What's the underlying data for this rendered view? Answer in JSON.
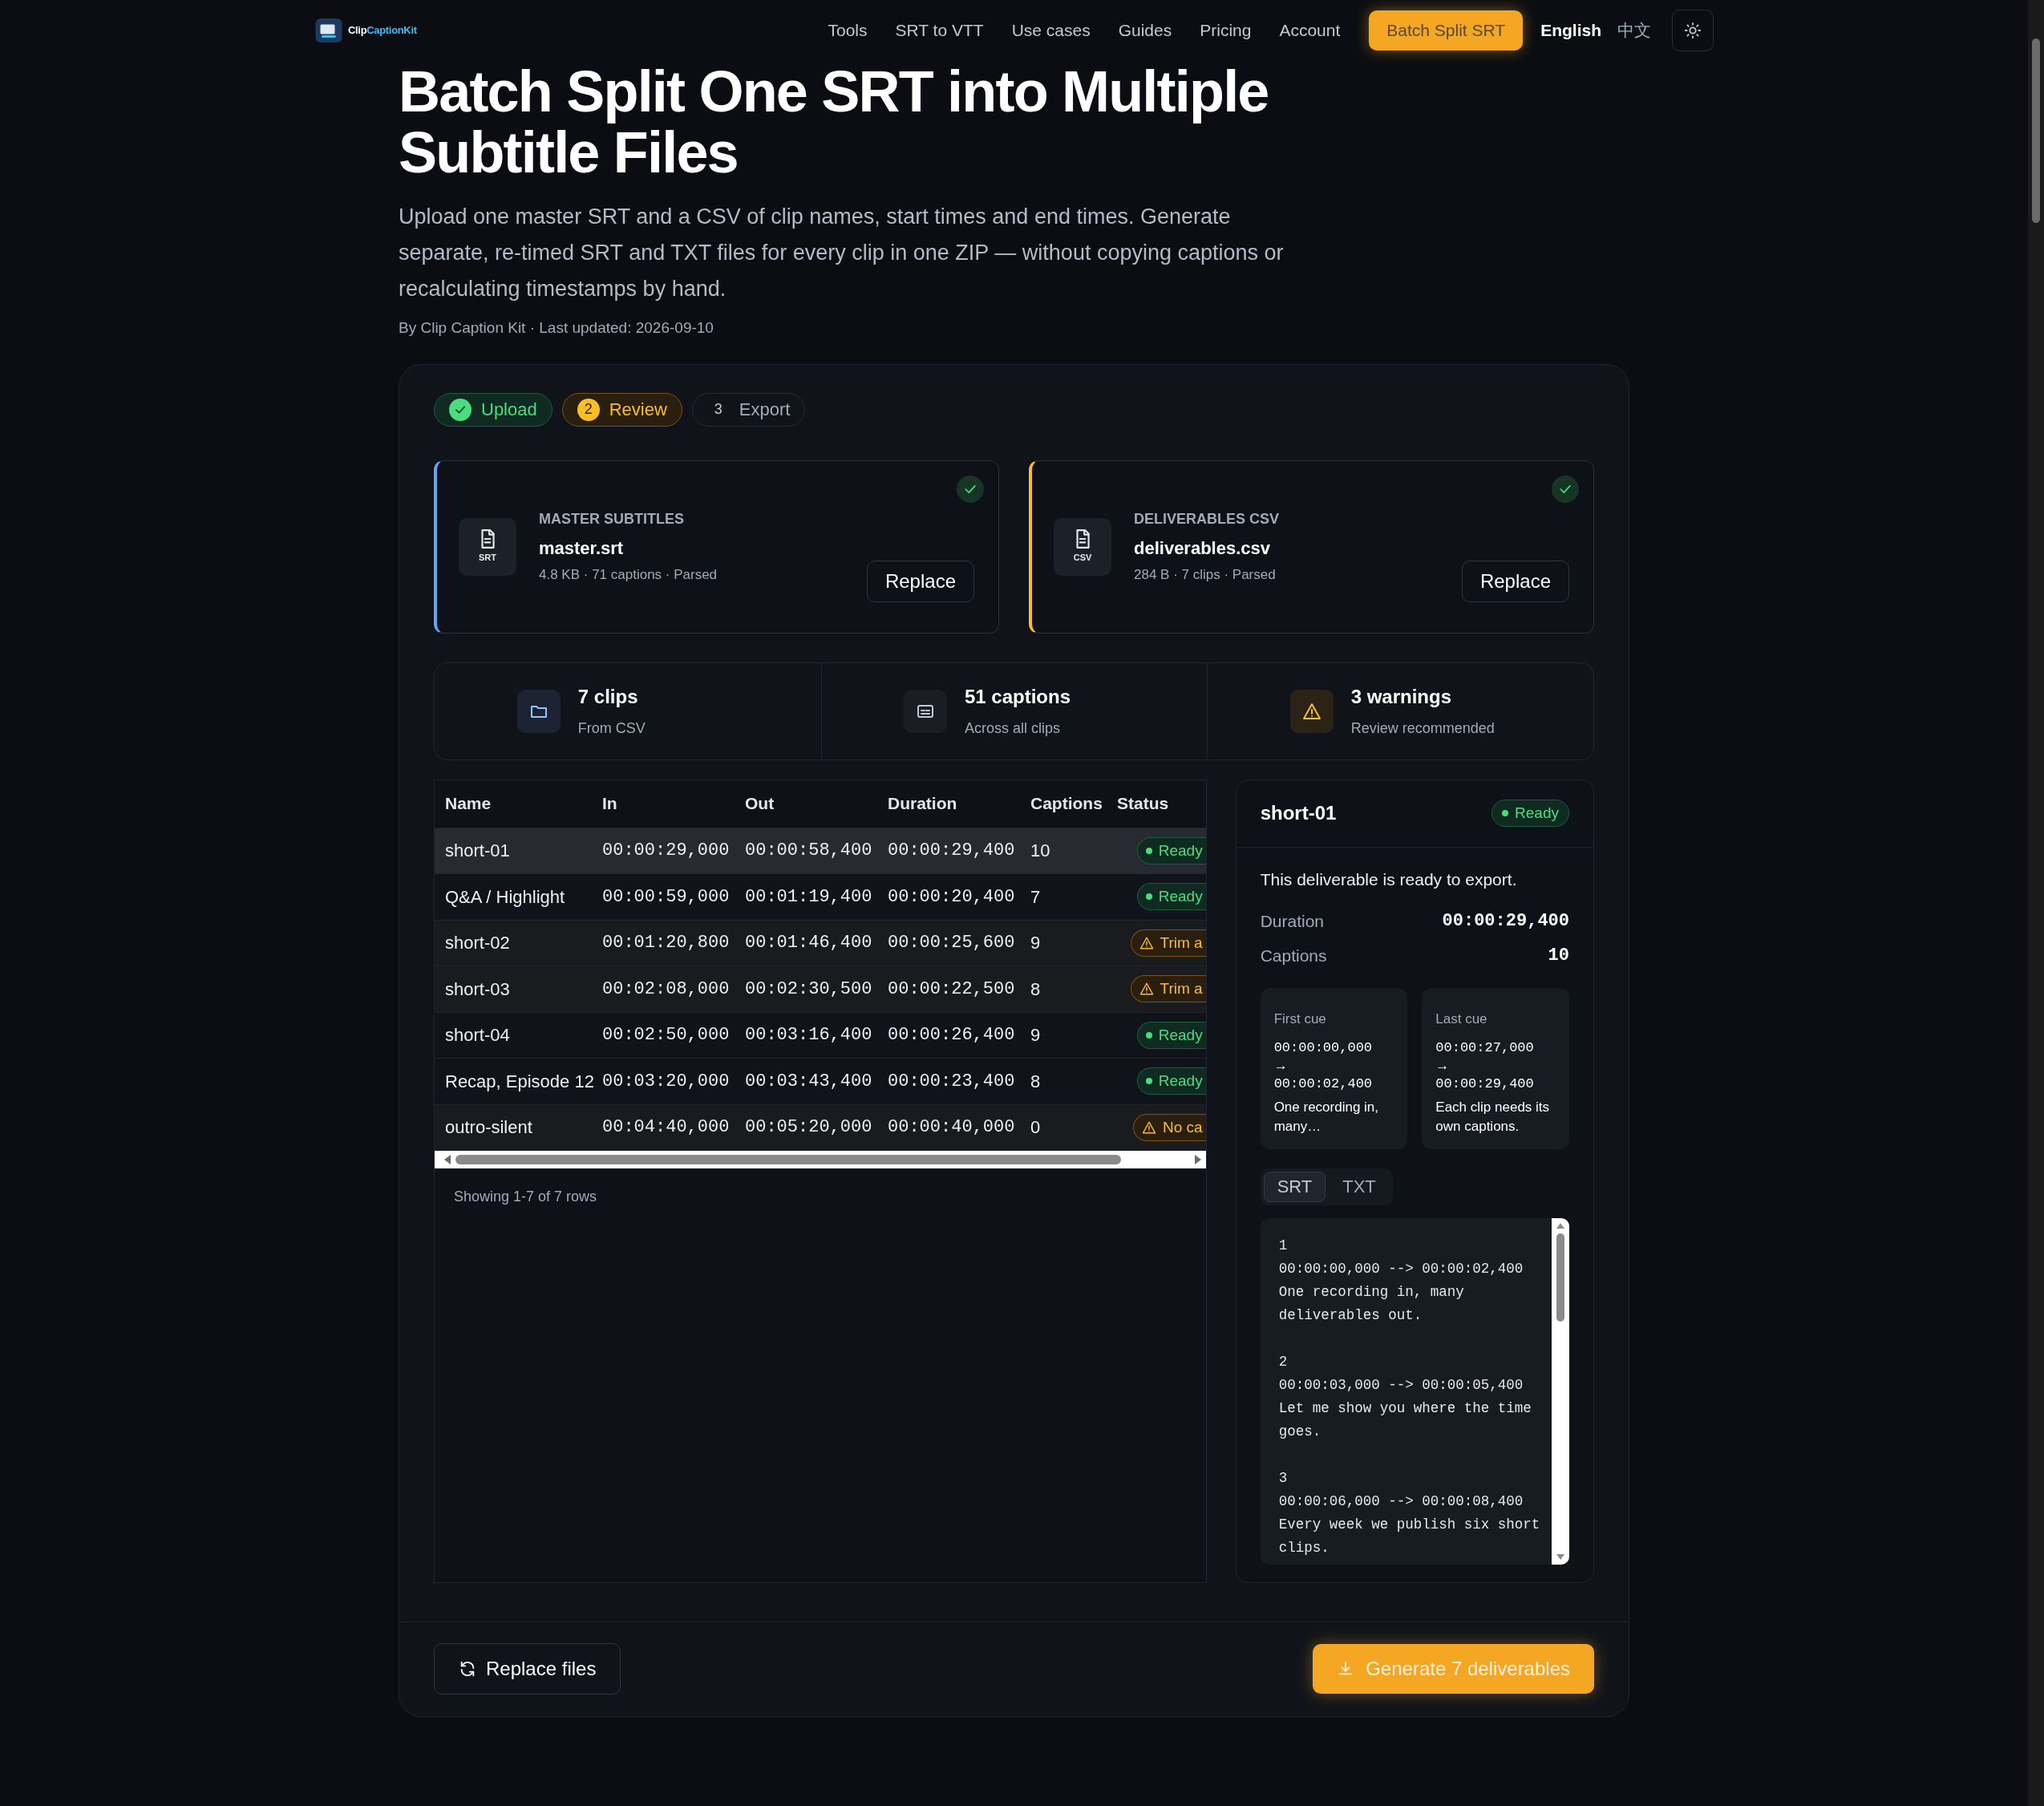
{
  "nav": {
    "brand": {
      "part1": "Clip",
      "part2": "CaptionKit"
    },
    "links": [
      "Tools",
      "SRT to VTT",
      "Use cases",
      "Guides",
      "Pricing",
      "Account"
    ],
    "cta": "Batch Split SRT",
    "languages": [
      {
        "label": "English",
        "selected": true
      },
      {
        "label": "中文",
        "selected": false
      }
    ]
  },
  "title": "Batch Split One SRT into Multiple Subtitle Files",
  "intro": "Upload one master SRT and a CSV of clip names, start times and end times. Generate separate, re-timed SRT and TXT files for every clip in one ZIP — without copying captions or recalculating timestamps by hand.",
  "byline": "By Clip Caption Kit · Last updated: 2026-09-10",
  "steps": [
    {
      "label": "Upload",
      "completed": true,
      "selected": false
    },
    {
      "number": "2",
      "label": "Review",
      "completed": false,
      "selected": true
    },
    {
      "number": "3",
      "label": "Export",
      "completed": false,
      "selected": false
    }
  ],
  "files": [
    {
      "tag": "SRT",
      "label": "MASTER SUBTITLES",
      "name": "master.srt",
      "meta": "4.8 KB · 71 captions · Parsed",
      "button": "Replace",
      "color": "#60a5fa",
      "parsed": true
    },
    {
      "tag": "CSV",
      "label": "DELIVERABLES CSV",
      "name": "deliverables.csv",
      "meta": "284 B · 7 clips · Parsed",
      "button": "Replace",
      "color": "#fbbf24",
      "parsed": true
    }
  ],
  "stats": [
    {
      "kind": "clips",
      "value": "7 clips",
      "caption": "From CSV"
    },
    {
      "kind": "captions",
      "value": "51 captions",
      "caption": "Across all clips"
    },
    {
      "kind": "warnings",
      "value": "3 warnings",
      "caption": "Review recommended"
    }
  ],
  "table": {
    "columns": [
      "Name",
      "In",
      "Out",
      "Duration",
      "Captions",
      "Status"
    ],
    "rows": [
      {
        "name": "short-01",
        "in": "00:00:29,000",
        "out": "00:00:58,400",
        "duration": "00:00:29,400",
        "captions": "10",
        "status": {
          "kind": "ready",
          "label": "Ready"
        },
        "selected": true
      },
      {
        "name": "Q&A / Highlight",
        "in": "00:00:59,000",
        "out": "00:01:19,400",
        "duration": "00:00:20,400",
        "captions": "7",
        "status": {
          "kind": "ready",
          "label": "Ready"
        },
        "selected": false
      },
      {
        "name": "short-02",
        "in": "00:01:20,800",
        "out": "00:01:46,400",
        "duration": "00:00:25,600",
        "captions": "9",
        "status": {
          "kind": "warning",
          "label": "Trim a"
        },
        "selected": false
      },
      {
        "name": "short-03",
        "in": "00:02:08,000",
        "out": "00:02:30,500",
        "duration": "00:00:22,500",
        "captions": "8",
        "status": {
          "kind": "warning",
          "label": "Trim a"
        },
        "selected": false
      },
      {
        "name": "short-04",
        "in": "00:02:50,000",
        "out": "00:03:16,400",
        "duration": "00:00:26,400",
        "captions": "9",
        "status": {
          "kind": "ready",
          "label": "Ready"
        },
        "selected": false
      },
      {
        "name": "Recap, Episode 12",
        "in": "00:03:20,000",
        "out": "00:03:43,400",
        "duration": "00:00:23,400",
        "captions": "8",
        "status": {
          "kind": "ready",
          "label": "Ready"
        },
        "selected": false
      },
      {
        "name": "outro-silent",
        "in": "00:04:40,000",
        "out": "00:05:20,000",
        "duration": "00:00:40,000",
        "captions": "0",
        "status": {
          "kind": "warning",
          "label": "No ca"
        },
        "selected": false
      }
    ],
    "footer": "Showing 1-7 of 7 rows"
  },
  "detail": {
    "title": "short-01",
    "status": {
      "kind": "ready",
      "label": "Ready"
    },
    "message": "This deliverable is ready to export.",
    "facts": [
      {
        "label": "Duration",
        "value": "00:00:29,400"
      },
      {
        "label": "Captions",
        "value": "10"
      }
    ],
    "cues": [
      {
        "label": "First cue",
        "start": "00:00:00,000",
        "arrow": "→",
        "end": "00:00:02,400",
        "text": "One recording in, many…"
      },
      {
        "label": "Last cue",
        "start": "00:00:27,000",
        "arrow": "→",
        "end": "00:00:29,400",
        "text": "Each clip needs its own captions."
      }
    ],
    "tabs": [
      {
        "label": "SRT",
        "selected": true
      },
      {
        "label": "TXT",
        "selected": false
      }
    ],
    "preview": [
      {
        "index": "1",
        "time": "00:00:00,000 --> 00:00:02,400",
        "text": "One recording in, many deliverables out."
      },
      {
        "index": "2",
        "time": "00:00:03,000 --> 00:00:05,400",
        "text": "Let me show you where the time goes."
      },
      {
        "index": "3",
        "time": "00:00:06,000 --> 00:00:08,400",
        "text": "Every week we publish six short clips."
      }
    ]
  },
  "actions": {
    "secondary": "Replace files",
    "primary": "Generate 7 deliverables"
  }
}
